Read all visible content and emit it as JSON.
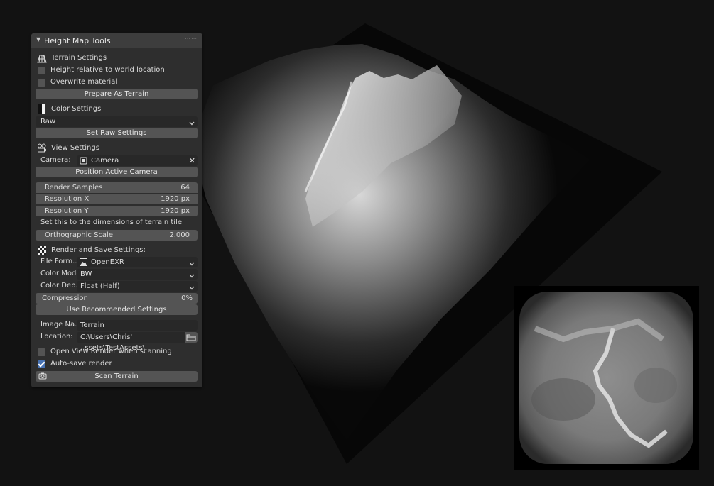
{
  "panel": {
    "title": "Height Map Tools",
    "terrain": {
      "heading": "Terrain Settings",
      "height_relative": {
        "label": "Height relative to world location",
        "checked": false
      },
      "overwrite_material": {
        "label": "Overwrite material",
        "checked": false
      },
      "prepare_button": "Prepare As Terrain"
    },
    "color": {
      "heading": "Color Settings",
      "mode_value": "Raw",
      "set_raw_button": "Set Raw Settings"
    },
    "view": {
      "heading": "View Settings",
      "camera_label": "Camera:",
      "camera_value": "Camera",
      "position_button": "Position Active Camera",
      "render_samples": {
        "label": "Render Samples",
        "value": "64"
      },
      "resolution_x": {
        "label": "Resolution X",
        "value": "1920 px"
      },
      "resolution_y": {
        "label": "Resolution Y",
        "value": "1920 px"
      },
      "hint": "Set this to the dimensions of terrain tile",
      "ortho_scale": {
        "label": "Orthographic Scale",
        "value": "2.000"
      }
    },
    "render": {
      "heading": "Render and Save Settings:",
      "file_format": {
        "label": "File Form..",
        "value": "OpenEXR"
      },
      "color_mode": {
        "label": "Color Mode",
        "value": "BW"
      },
      "color_depth": {
        "label": "Color Dep..",
        "value": "Float (Half)"
      },
      "compression": {
        "label": "Compression",
        "value": "0%"
      },
      "recommended_button": "Use Recommended Settings",
      "image_name": {
        "label": "Image Na..",
        "value": "Terrain"
      },
      "location": {
        "label": "Location:",
        "value": "C:\\Users\\Chris' ..ssets\\TestAssets\\"
      },
      "open_view": {
        "label": "Open View Render when scanning",
        "checked": false
      },
      "auto_save": {
        "label": "Auto-save render",
        "checked": true
      },
      "scan_button": "Scan Terrain"
    }
  },
  "icons": [
    "collapse-triangle-icon",
    "grid-icon",
    "color-swatch-icon",
    "camera-icon",
    "checker-icon",
    "image-icon",
    "folder-icon",
    "render-camera-icon",
    "chevron-down-icon",
    "close-icon"
  ],
  "colors": {
    "panel_bg": "#2e2e2e",
    "button": "#545454",
    "field_dark": "#282828",
    "check_on": "#4772b3",
    "viewport_bg": "#121212"
  }
}
